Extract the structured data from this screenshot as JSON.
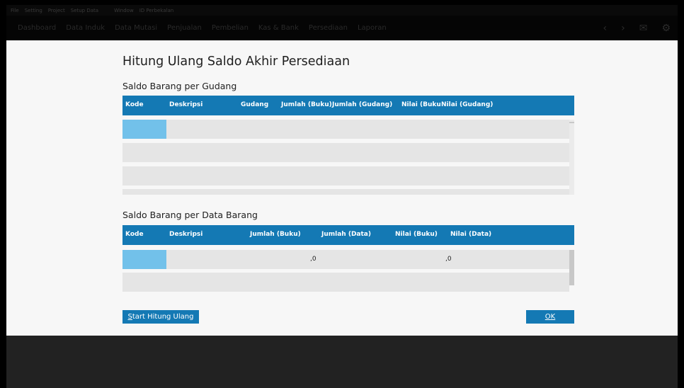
{
  "menubar": {
    "items": [
      "File",
      "Setting",
      "Project",
      "Setup Data",
      "Window",
      "ID Perbekalan"
    ]
  },
  "navbar": {
    "items": [
      "Dashboard",
      "Data Induk",
      "Data Mutasi",
      "Penjualan",
      "Pembelian",
      "Kas & Bank",
      "Persediaan",
      "Laporan"
    ],
    "tools": [
      "chevron-left",
      "chevron-right",
      "mail",
      "settings"
    ]
  },
  "dialog": {
    "title": "Hitung Ulang Saldo Akhir Persediaan",
    "section1": {
      "title": "Saldo Barang per Gudang",
      "columns": [
        "Kode",
        "Deskripsi",
        "Gudang",
        "Jumlah (Buku)",
        "Jumlah (Gudang)",
        "Nilai (Buku)",
        "Nilai (Gudang)"
      ]
    },
    "section2": {
      "title": "Saldo Barang per Data Barang",
      "columns": [
        "Kode",
        "Deskripsi",
        "Jumlah (Buku)",
        "Jumlah (Data)",
        "Nilai (Buku)",
        "Nilai (Data)"
      ],
      "rows": [
        {
          "jumlah_data": ",0",
          "nilai_data": ",0"
        }
      ]
    },
    "start_button": {
      "mnemonic": "S",
      "rest": "tart Hitung Ulang"
    },
    "ok_button": {
      "mnemonic": "O",
      "rest": "K"
    }
  }
}
